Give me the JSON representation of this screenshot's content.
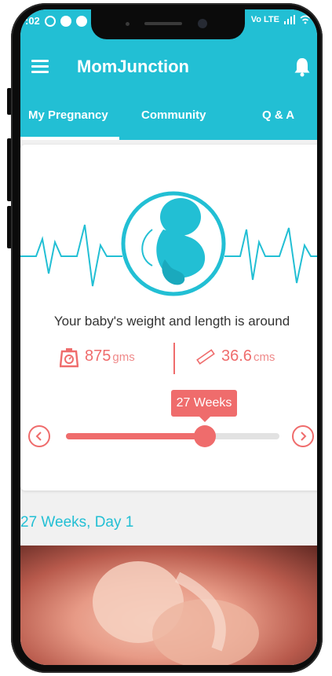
{
  "status_bar": {
    "time": ":02",
    "right_text": "Vo LTE"
  },
  "app": {
    "title": "MomJunction"
  },
  "tabs": [
    {
      "label": "My Pregnancy",
      "active": true
    },
    {
      "label": "Community",
      "active": false
    },
    {
      "label": "Q & A",
      "active": false
    }
  ],
  "baby": {
    "caption": "Your baby's weight and length is around",
    "weight_value": "875",
    "weight_unit": "gms",
    "length_value": "36.6",
    "length_unit": "cms"
  },
  "week_slider": {
    "label": "27 Weeks",
    "level_fraction": 0.65
  },
  "section": {
    "title": "27 Weeks, Day 1"
  },
  "colors": {
    "brand": "#22bfd4",
    "accent": "#ef6c6c"
  },
  "icons": [
    "menu-icon",
    "bell-icon",
    "scale-icon",
    "ruler-icon",
    "chevron-left-icon",
    "chevron-right-icon",
    "fetus-icon"
  ]
}
